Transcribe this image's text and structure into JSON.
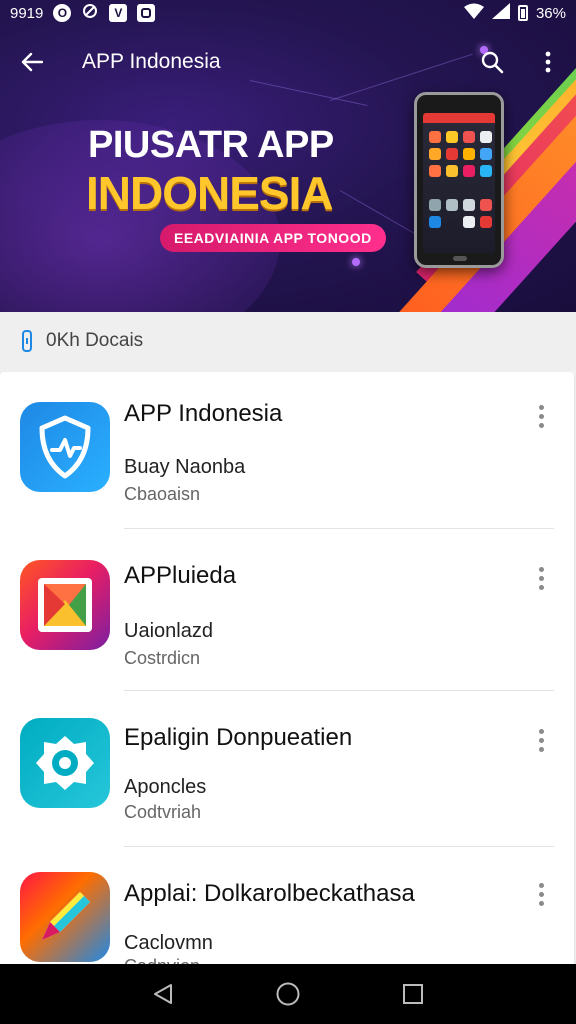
{
  "status_bar": {
    "time": "9919",
    "badge_1": "O",
    "badge_2": "V",
    "battery_text": "36%"
  },
  "app_bar": {
    "title": "APP Indonesia",
    "back_icon": "arrow-left-icon",
    "search_icon": "search-icon",
    "menu_icon": "more-vert-icon"
  },
  "banner": {
    "line1": "PIUSATR APP",
    "line2": "INDONESIA",
    "pill": "EEADVIAINIA APP TONOOD"
  },
  "section": {
    "label": "0Kh Docais",
    "icon": "phone-icon"
  },
  "items": [
    {
      "title": "APP Indonesia",
      "subtitle": "Buay Naonba",
      "caption": "Cbaoaisn",
      "icon": "shield-icon",
      "colors": [
        "#1e88e5",
        "#2ab0ff"
      ]
    },
    {
      "title": "APPluieda",
      "subtitle": "Uaionlazd",
      "caption": "Costrdicn",
      "icon": "gallery-icon",
      "colors": [
        "#ff5722",
        "#7b1fa2"
      ]
    },
    {
      "title": "Epaligin Donpueatien",
      "subtitle": "Aponcles",
      "caption": "Codtvriah",
      "icon": "gear-icon",
      "colors": [
        "#00acc1",
        "#26c6da"
      ]
    },
    {
      "title": "Applai: Dolkarolbeckathasa",
      "subtitle": "Caclovmn",
      "caption": "Cadnvion",
      "icon": "pencil-icon",
      "colors": [
        "#ff1744",
        "#1e88e5"
      ]
    }
  ],
  "nav": {
    "back": "triangle-back-icon",
    "home": "circle-home-icon",
    "recents": "square-recents-icon"
  },
  "colors": {
    "hero_bg": "#241552",
    "accent_yellow": "#ffc72c",
    "accent_pink": "#e91e75",
    "list_bg": "#ffffff"
  }
}
